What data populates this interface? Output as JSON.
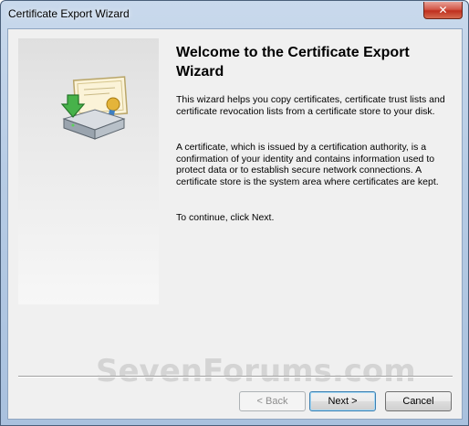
{
  "window": {
    "title": "Certificate Export Wizard",
    "close_glyph": "✕"
  },
  "content": {
    "heading": "Welcome to the Certificate Export Wizard",
    "paragraph1": "This wizard helps you copy certificates, certificate trust lists and certificate revocation lists from a certificate store to your disk.",
    "paragraph2": "A certificate, which is issued by a certification authority, is a confirmation of your identity and contains information used to protect data or to establish secure network connections. A certificate store is the system area where certificates are kept.",
    "paragraph3": "To continue, click Next."
  },
  "buttons": {
    "back": "< Back",
    "next": "Next >",
    "cancel": "Cancel"
  },
  "watermark": "SevenForums.com",
  "icons": {
    "wizard": "certificate-export-icon"
  },
  "colors": {
    "client_bg": "#f0f0f0",
    "close_red": "#c0301f",
    "default_button_border": "#3c7fb1"
  }
}
